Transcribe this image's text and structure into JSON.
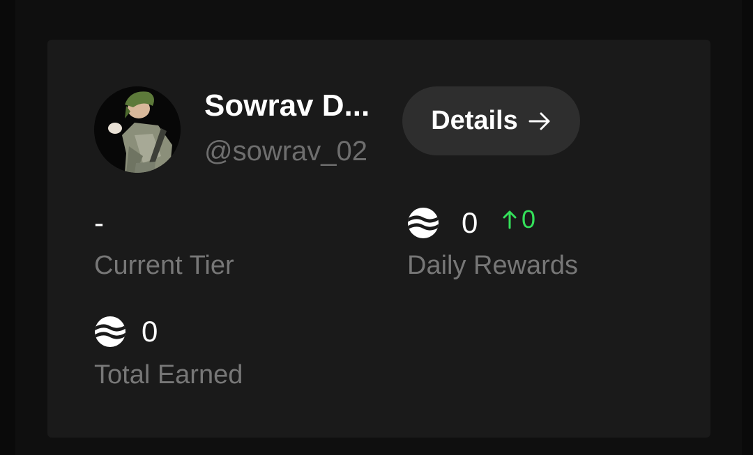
{
  "profile": {
    "name": "Sowrav D...",
    "handle": "@sowrav_02",
    "avatar_icon": "anime-character-avatar"
  },
  "details_button": {
    "label": "Details",
    "icon": "arrow-right-icon"
  },
  "stats": {
    "current_tier": {
      "value": "-",
      "label": "Current Tier"
    },
    "daily_rewards": {
      "value": "0",
      "change": "0",
      "label": "Daily Rewards",
      "icon": "token-logo-icon"
    },
    "total_earned": {
      "value": "0",
      "label": "Total Earned",
      "icon": "token-logo-icon"
    }
  },
  "colors": {
    "page_bg": "#0a0a0a",
    "card_bg": "#1a1a1a",
    "button_bg": "#2e2e2e",
    "muted_text": "#777777",
    "positive": "#34e05a"
  }
}
